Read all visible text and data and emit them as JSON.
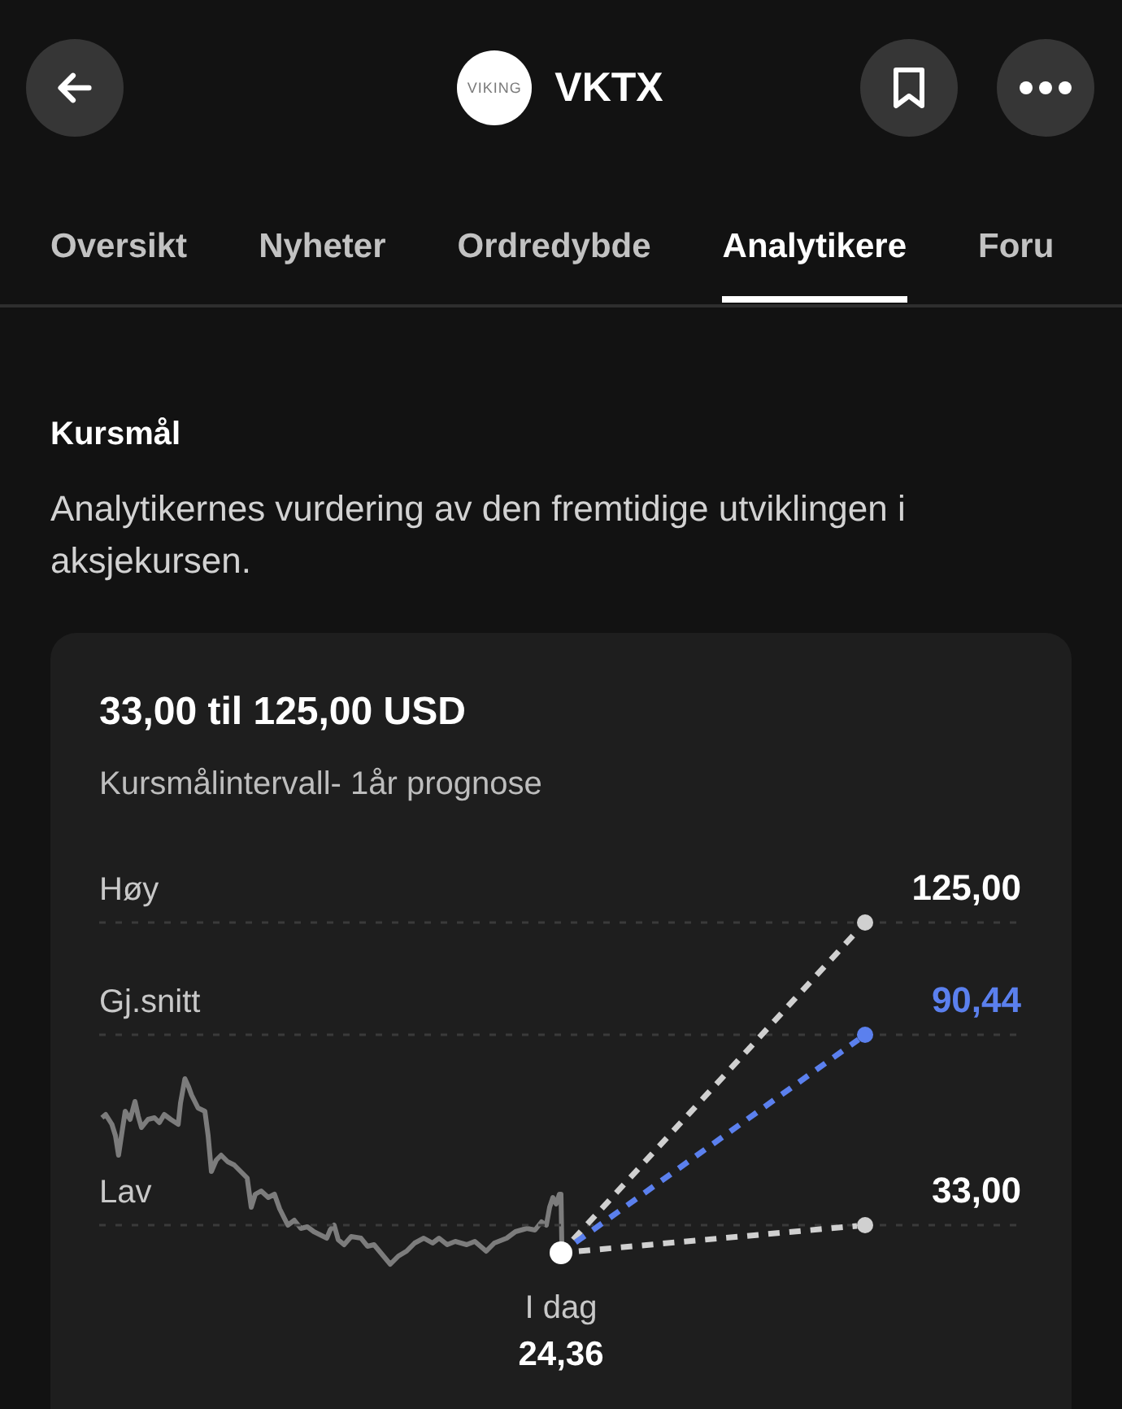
{
  "header": {
    "logo_text": "VIKING",
    "ticker": "VKTX"
  },
  "tabs": [
    {
      "label": "Oversikt",
      "selected": false
    },
    {
      "label": "Nyheter",
      "selected": false
    },
    {
      "label": "Ordredybde",
      "selected": false
    },
    {
      "label": "Analytikere",
      "selected": true
    },
    {
      "label": "Foru",
      "selected": false
    }
  ],
  "section": {
    "title": "Kursmål",
    "description": "Analytikernes vurdering av den fremtidige utviklingen i aksjekursen."
  },
  "card": {
    "range": "33,00 til 125,00 USD",
    "subtitle": "Kursmålintervall- 1år prognose",
    "targets": [
      {
        "kind": "high",
        "label": "Høy",
        "value": "125,00",
        "color": "#d0d0d0"
      },
      {
        "kind": "average",
        "label": "Gj.snitt",
        "value": "90,44",
        "color": "#5b80ee"
      },
      {
        "kind": "low",
        "label": "Lav",
        "value": "33,00",
        "color": "#d0d0d0"
      }
    ],
    "today": {
      "label": "I dag",
      "value": "24,36"
    }
  }
}
